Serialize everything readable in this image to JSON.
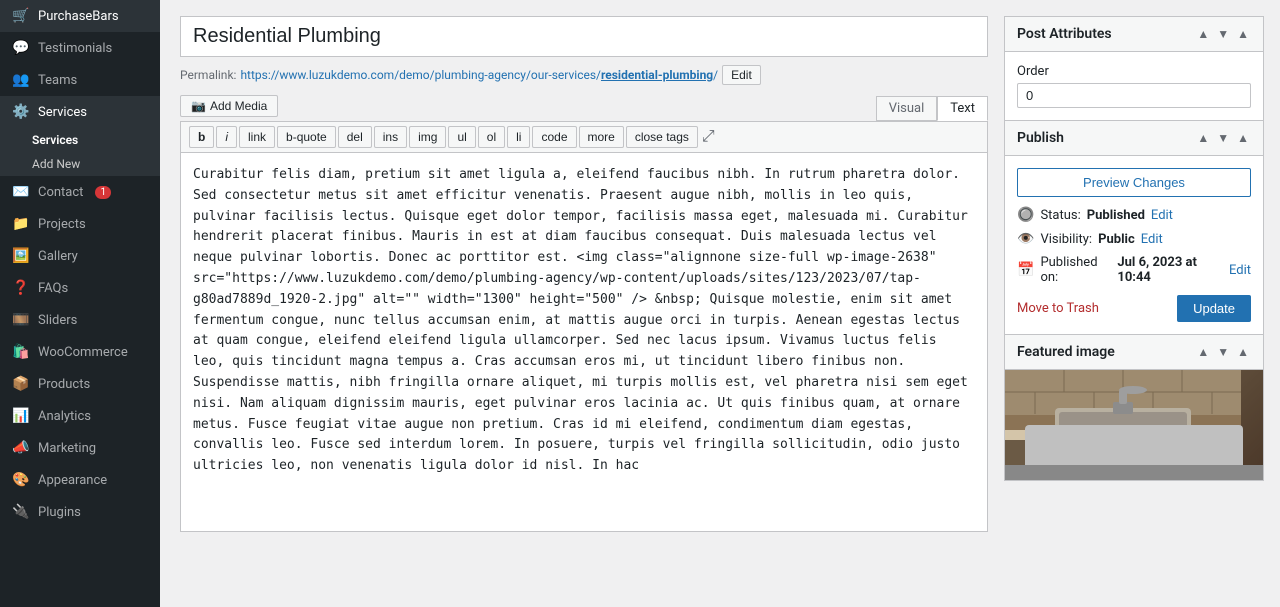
{
  "sidebar": {
    "items": [
      {
        "id": "purchase-bars",
        "label": "PurchaseBars",
        "icon": "🛒",
        "badge": null
      },
      {
        "id": "testimonials",
        "label": "Testimonials",
        "icon": "💬",
        "badge": null
      },
      {
        "id": "teams",
        "label": "Teams",
        "icon": "👥",
        "badge": null
      },
      {
        "id": "services",
        "label": "Services",
        "icon": "⚙️",
        "badge": null,
        "active": true
      },
      {
        "id": "contact",
        "label": "Contact",
        "icon": "✉️",
        "badge": "1"
      },
      {
        "id": "projects",
        "label": "Projects",
        "icon": "📁",
        "badge": null
      },
      {
        "id": "gallery",
        "label": "Gallery",
        "icon": "🖼️",
        "badge": null
      },
      {
        "id": "faqs",
        "label": "FAQs",
        "icon": "❓",
        "badge": null
      },
      {
        "id": "sliders",
        "label": "Sliders",
        "icon": "🎞️",
        "badge": null
      },
      {
        "id": "woocommerce",
        "label": "WooCommerce",
        "icon": "🛍️",
        "badge": null
      },
      {
        "id": "products",
        "label": "Products",
        "icon": "📦",
        "badge": null
      },
      {
        "id": "analytics",
        "label": "Analytics",
        "icon": "📊",
        "badge": null
      },
      {
        "id": "marketing",
        "label": "Marketing",
        "icon": "📣",
        "badge": null
      },
      {
        "id": "appearance",
        "label": "Appearance",
        "icon": "🎨",
        "badge": null
      },
      {
        "id": "plugins",
        "label": "Plugins",
        "icon": "🔌",
        "badge": null
      }
    ],
    "services_sub": {
      "label": "Services",
      "add_new": "Add New"
    }
  },
  "editor": {
    "title": "Residential Plumbing",
    "permalink_label": "Permalink:",
    "permalink_url": "https://www.luzukdemo.com/demo/plumbing-agency/our-services/",
    "permalink_slug": "residential-plumbing",
    "permalink_full": "https://www.luzukdemo.com/demo/plumbing-agency/our-services/residential-plumbing/",
    "permalink_edit_btn": "Edit",
    "add_media_label": "Add Media",
    "visual_tab": "Visual",
    "text_tab": "Text",
    "format_buttons": [
      "b",
      "i",
      "link",
      "b-quote",
      "del",
      "ins",
      "img",
      "ul",
      "ol",
      "li",
      "code",
      "more",
      "close tags"
    ],
    "content": "Curabitur felis diam, pretium sit amet ligula a, eleifend faucibus nibh. In rutrum pharetra dolor. Sed consectetur metus sit amet efficitur venenatis. Praesent augue nibh, mollis in leo quis, pulvinar facilisis lectus. Quisque eget dolor tempor, facilisis massa eget, malesuada mi. Curabitur hendrerit placerat finibus. Mauris in est at diam faucibus consequat. Duis malesuada lectus vel neque pulvinar lobortis. Donec ac porttitor est.\n\n<img class=\"alignnone size-full wp-image-2638\" src=\"https://www.luzukdemo.com/demo/plumbing-agency/wp-content/uploads/sites/123/2023/07/tap-g80ad7889d_1920-2.jpg\" alt=\"\" width=\"1300\" height=\"500\" />\n\n&nbsp;\n\nQuisque molestie, enim sit amet fermentum congue, nunc tellus accumsan enim, at mattis augue orci in turpis. Aenean egestas lectus at quam congue, eleifend eleifend ligula ullamcorper. Sed nec lacus ipsum. Vivamus luctus felis leo, quis tincidunt magna tempus a. Cras accumsan eros mi, ut tincidunt libero finibus non. Suspendisse mattis, nibh fringilla ornare aliquet, mi turpis mollis est, vel pharetra nisi sem eget nisi. Nam aliquam dignissim mauris, eget pulvinar eros lacinia ac.\n\nUt quis finibus quam, at ornare metus. Fusce feugiat vitae augue non pretium. Cras id mi eleifend, condimentum diam egestas, convallis leo. Fusce sed interdum lorem. In posuere, turpis vel fringilla sollicitudin, odio justo ultricies leo, non venenatis ligula dolor id nisl. In hac"
  },
  "post_attributes": {
    "title": "Post Attributes",
    "order_label": "Order",
    "order_value": "0"
  },
  "publish": {
    "title": "Publish",
    "preview_btn": "Preview Changes",
    "status_label": "Status:",
    "status_value": "Published",
    "status_edit": "Edit",
    "visibility_label": "Visibility:",
    "visibility_value": "Public",
    "visibility_edit": "Edit",
    "published_label": "Published on:",
    "published_value": "Jul 6, 2023 at 10:44",
    "published_edit": "Edit",
    "move_trash": "Move to Trash",
    "update_btn": "Update"
  },
  "featured_image": {
    "title": "Featured image"
  }
}
